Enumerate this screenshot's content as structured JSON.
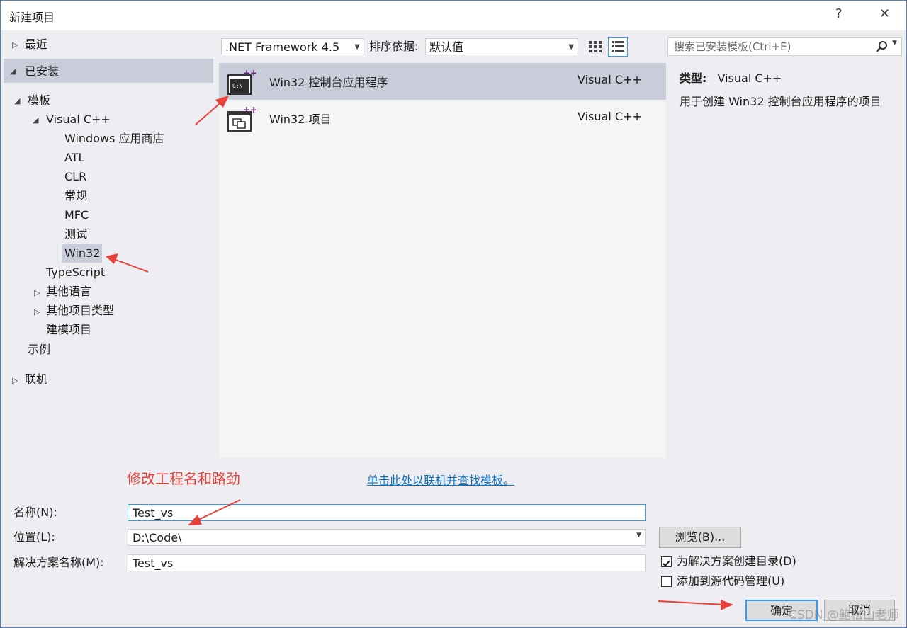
{
  "window": {
    "title": "新建项目",
    "help": "?",
    "close": "✕"
  },
  "tree": {
    "recent": "最近",
    "installed": "已安装",
    "templates": "模板",
    "visual_cpp": "Visual C++",
    "children": [
      "Windows 应用商店",
      "ATL",
      "CLR",
      "常规",
      "MFC",
      "测试",
      "Win32"
    ],
    "typescript": "TypeScript",
    "other_languages": "其他语言",
    "other_project_types": "其他项目类型",
    "modeling": "建模项目",
    "samples": "示例",
    "online": "联机"
  },
  "toolbar": {
    "framework": ".NET Framework 4.5",
    "sort_label": "排序依据:",
    "sort_value": "默认值",
    "search_placeholder": "搜索已安装模板(Ctrl+E)"
  },
  "templates": [
    {
      "name": "Win32 控制台应用程序",
      "lang": "Visual C++",
      "selected": true
    },
    {
      "name": "Win32 项目",
      "lang": "Visual C++",
      "selected": false
    }
  ],
  "details": {
    "type_label": "类型:",
    "type_value": "Visual C++",
    "description": "用于创建 Win32 控制台应用程序的项目"
  },
  "online_link": "单击此处以联机并查找模板。",
  "annotation": "修改工程名和路劲",
  "form": {
    "name_label": "名称(N):",
    "name_value": "Test_vs",
    "location_label": "位置(L):",
    "location_value": "D:\\Code\\",
    "solution_label": "解决方案名称(M):",
    "solution_value": "Test_vs",
    "browse": "浏览(B)...",
    "create_dir": "为解决方案创建目录(D)",
    "create_dir_checked": true,
    "add_source_control": "添加到源代码管理(U)",
    "add_source_control_checked": false,
    "ok": "确定",
    "cancel": "取消"
  },
  "watermark": "CSDN @鲍松山老师",
  "colors": {
    "accent": "#0e70c0",
    "selection": "#c9ccd9",
    "annotation": "#e8413a"
  }
}
